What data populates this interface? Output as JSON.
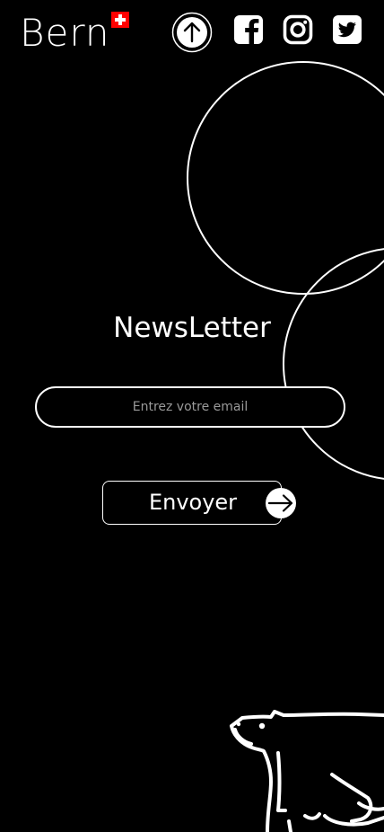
{
  "header": {
    "logo_text": "Bern",
    "flag_icon": "swiss-flag-icon",
    "scroll_up_icon": "arrow-up-circle-icon",
    "social": [
      {
        "name": "facebook",
        "icon": "facebook-icon"
      },
      {
        "name": "instagram",
        "icon": "instagram-icon"
      },
      {
        "name": "twitter",
        "icon": "twitter-icon"
      }
    ]
  },
  "newsletter": {
    "title": "NewsLetter",
    "email_placeholder": "Entrez votre email",
    "email_value": "",
    "submit_label": "Envoyer",
    "submit_icon": "arrow-right-icon"
  },
  "decor": {
    "bear_icon": "bear-outline-icon"
  },
  "colors": {
    "background": "#000000",
    "foreground": "#ffffff",
    "flag_red": "#ff0000",
    "placeholder": "#9a9a9a"
  }
}
